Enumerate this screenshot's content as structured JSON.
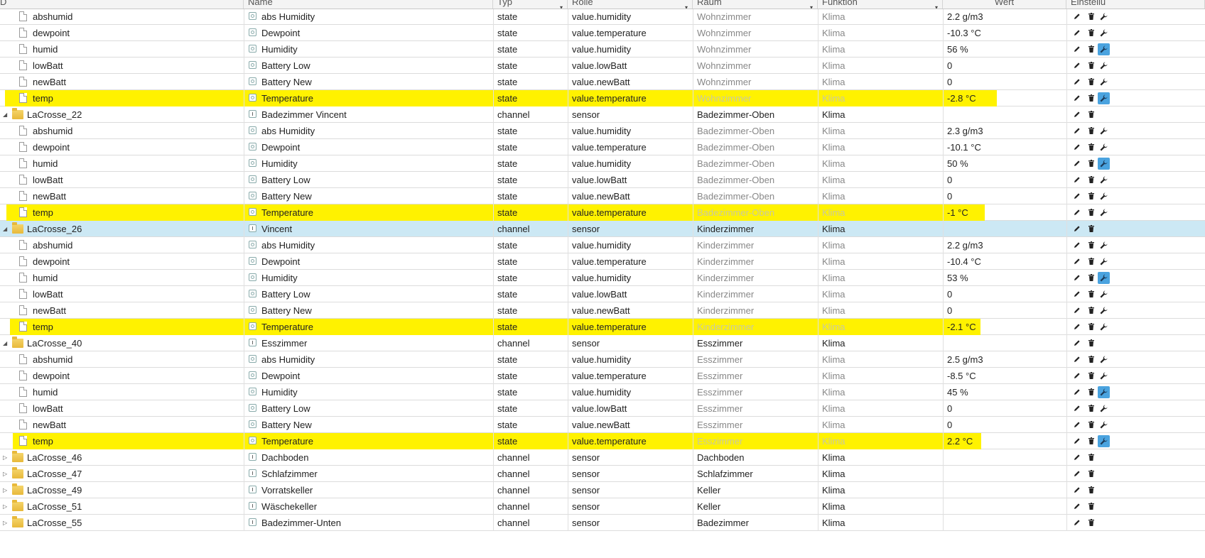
{
  "header": {
    "columns": [
      {
        "key": "id",
        "label": "D"
      },
      {
        "key": "name",
        "label": "Name"
      },
      {
        "key": "type",
        "label": "Typ"
      },
      {
        "key": "role",
        "label": "Rolle"
      },
      {
        "key": "room",
        "label": "Raum"
      },
      {
        "key": "func",
        "label": "Funktion"
      },
      {
        "key": "value",
        "label": "Wert"
      },
      {
        "key": "settings",
        "label": "Einstellu"
      }
    ]
  },
  "rows": [
    {
      "kind": "state",
      "id": "abshumid",
      "name": "abs Humidity",
      "type": "state",
      "role": "value.humidity",
      "room": "Wohnzimmer",
      "func": "Klima",
      "value": "2.2 g/m3",
      "highlight": false,
      "wrench": false
    },
    {
      "kind": "state",
      "id": "dewpoint",
      "name": "Dewpoint",
      "type": "state",
      "role": "value.temperature",
      "room": "Wohnzimmer",
      "func": "Klima",
      "value": "-10.3 °C",
      "highlight": false,
      "wrench": false
    },
    {
      "kind": "state",
      "id": "humid",
      "name": "Humidity",
      "type": "state",
      "role": "value.humidity",
      "room": "Wohnzimmer",
      "func": "Klima",
      "value": "56 %",
      "highlight": false,
      "wrench": true
    },
    {
      "kind": "state",
      "id": "lowBatt",
      "name": "Battery Low",
      "type": "state",
      "role": "value.lowBatt",
      "room": "Wohnzimmer",
      "func": "Klima",
      "value": "0",
      "highlight": false,
      "wrench": false
    },
    {
      "kind": "state",
      "id": "newBatt",
      "name": "Battery New",
      "type": "state",
      "role": "value.newBatt",
      "room": "Wohnzimmer",
      "func": "Klima",
      "value": "0",
      "highlight": false,
      "wrench": false
    },
    {
      "kind": "state",
      "id": "temp",
      "name": "Temperature",
      "type": "state",
      "role": "value.temperature",
      "room": "Wohnzimmer",
      "func": "Klima",
      "value": "-2.8 °C",
      "highlight": true,
      "wrench": true
    },
    {
      "kind": "channel",
      "id": "LaCrosse_22",
      "name": "Badezimmer Vincent",
      "type": "channel",
      "role": "sensor",
      "room": "Badezimmer-Oben",
      "func": "Klima",
      "value": "",
      "expanded": true,
      "selected": false
    },
    {
      "kind": "state",
      "id": "abshumid",
      "name": "abs Humidity",
      "type": "state",
      "role": "value.humidity",
      "room": "Badezimmer-Oben",
      "func": "Klima",
      "value": "2.3 g/m3",
      "highlight": false,
      "wrench": false
    },
    {
      "kind": "state",
      "id": "dewpoint",
      "name": "Dewpoint",
      "type": "state",
      "role": "value.temperature",
      "room": "Badezimmer-Oben",
      "func": "Klima",
      "value": "-10.1 °C",
      "highlight": false,
      "wrench": false
    },
    {
      "kind": "state",
      "id": "humid",
      "name": "Humidity",
      "type": "state",
      "role": "value.humidity",
      "room": "Badezimmer-Oben",
      "func": "Klima",
      "value": "50 %",
      "highlight": false,
      "wrench": true
    },
    {
      "kind": "state",
      "id": "lowBatt",
      "name": "Battery Low",
      "type": "state",
      "role": "value.lowBatt",
      "room": "Badezimmer-Oben",
      "func": "Klima",
      "value": "0",
      "highlight": false,
      "wrench": false
    },
    {
      "kind": "state",
      "id": "newBatt",
      "name": "Battery New",
      "type": "state",
      "role": "value.newBatt",
      "room": "Badezimmer-Oben",
      "func": "Klima",
      "value": "0",
      "highlight": false,
      "wrench": false
    },
    {
      "kind": "state",
      "id": "temp",
      "name": "Temperature",
      "type": "state",
      "role": "value.temperature",
      "room": "Badezimmer-Oben",
      "func": "Klima",
      "value": "-1 °C",
      "highlight": true,
      "wrench": false
    },
    {
      "kind": "channel",
      "id": "LaCrosse_26",
      "name": "Vincent",
      "type": "channel",
      "role": "sensor",
      "room": "Kinderzimmer",
      "func": "Klima",
      "value": "",
      "expanded": true,
      "selected": true
    },
    {
      "kind": "state",
      "id": "abshumid",
      "name": "abs Humidity",
      "type": "state",
      "role": "value.humidity",
      "room": "Kinderzimmer",
      "func": "Klima",
      "value": "2.2 g/m3",
      "highlight": false,
      "wrench": false
    },
    {
      "kind": "state",
      "id": "dewpoint",
      "name": "Dewpoint",
      "type": "state",
      "role": "value.temperature",
      "room": "Kinderzimmer",
      "func": "Klima",
      "value": "-10.4 °C",
      "highlight": false,
      "wrench": false
    },
    {
      "kind": "state",
      "id": "humid",
      "name": "Humidity",
      "type": "state",
      "role": "value.humidity",
      "room": "Kinderzimmer",
      "func": "Klima",
      "value": "53 %",
      "highlight": false,
      "wrench": true
    },
    {
      "kind": "state",
      "id": "lowBatt",
      "name": "Battery Low",
      "type": "state",
      "role": "value.lowBatt",
      "room": "Kinderzimmer",
      "func": "Klima",
      "value": "0",
      "highlight": false,
      "wrench": false
    },
    {
      "kind": "state",
      "id": "newBatt",
      "name": "Battery New",
      "type": "state",
      "role": "value.newBatt",
      "room": "Kinderzimmer",
      "func": "Klima",
      "value": "0",
      "highlight": false,
      "wrench": false
    },
    {
      "kind": "state",
      "id": "temp",
      "name": "Temperature",
      "type": "state",
      "role": "value.temperature",
      "room": "Kinderzimmer",
      "func": "Klima",
      "value": "-2.1 °C",
      "highlight": true,
      "wrench": false
    },
    {
      "kind": "channel",
      "id": "LaCrosse_40",
      "name": "Esszimmer",
      "type": "channel",
      "role": "sensor",
      "room": "Esszimmer",
      "func": "Klima",
      "value": "",
      "expanded": true,
      "selected": false
    },
    {
      "kind": "state",
      "id": "abshumid",
      "name": "abs Humidity",
      "type": "state",
      "role": "value.humidity",
      "room": "Esszimmer",
      "func": "Klima",
      "value": "2.5 g/m3",
      "highlight": false,
      "wrench": false
    },
    {
      "kind": "state",
      "id": "dewpoint",
      "name": "Dewpoint",
      "type": "state",
      "role": "value.temperature",
      "room": "Esszimmer",
      "func": "Klima",
      "value": "-8.5 °C",
      "highlight": false,
      "wrench": false
    },
    {
      "kind": "state",
      "id": "humid",
      "name": "Humidity",
      "type": "state",
      "role": "value.humidity",
      "room": "Esszimmer",
      "func": "Klima",
      "value": "45 %",
      "highlight": false,
      "wrench": true
    },
    {
      "kind": "state",
      "id": "lowBatt",
      "name": "Battery Low",
      "type": "state",
      "role": "value.lowBatt",
      "room": "Esszimmer",
      "func": "Klima",
      "value": "0",
      "highlight": false,
      "wrench": false
    },
    {
      "kind": "state",
      "id": "newBatt",
      "name": "Battery New",
      "type": "state",
      "role": "value.newBatt",
      "room": "Esszimmer",
      "func": "Klima",
      "value": "0",
      "highlight": false,
      "wrench": false
    },
    {
      "kind": "state",
      "id": "temp",
      "name": "Temperature",
      "type": "state",
      "role": "value.temperature",
      "room": "Esszimmer",
      "func": "Klima",
      "value": "2.2 °C",
      "highlight": true,
      "wrench": true
    },
    {
      "kind": "channel",
      "id": "LaCrosse_46",
      "name": "Dachboden",
      "type": "channel",
      "role": "sensor",
      "room": "Dachboden",
      "func": "Klima",
      "value": "",
      "expanded": false,
      "selected": false
    },
    {
      "kind": "channel",
      "id": "LaCrosse_47",
      "name": "Schlafzimmer",
      "type": "channel",
      "role": "sensor",
      "room": "Schlafzimmer",
      "func": "Klima",
      "value": "",
      "expanded": false,
      "selected": false
    },
    {
      "kind": "channel",
      "id": "LaCrosse_49",
      "name": "Vorratskeller",
      "type": "channel",
      "role": "sensor",
      "room": "Keller",
      "func": "Klima",
      "value": "",
      "expanded": false,
      "selected": false
    },
    {
      "kind": "channel",
      "id": "LaCrosse_51",
      "name": "Wäschekeller",
      "type": "channel",
      "role": "sensor",
      "room": "Keller",
      "func": "Klima",
      "value": "",
      "expanded": false,
      "selected": false
    },
    {
      "kind": "channel",
      "id": "LaCrosse_55",
      "name": "Badezimmer-Unten",
      "type": "channel",
      "role": "sensor",
      "room": "Badezimmer",
      "func": "Klima",
      "value": "",
      "expanded": false,
      "selected": false
    }
  ]
}
